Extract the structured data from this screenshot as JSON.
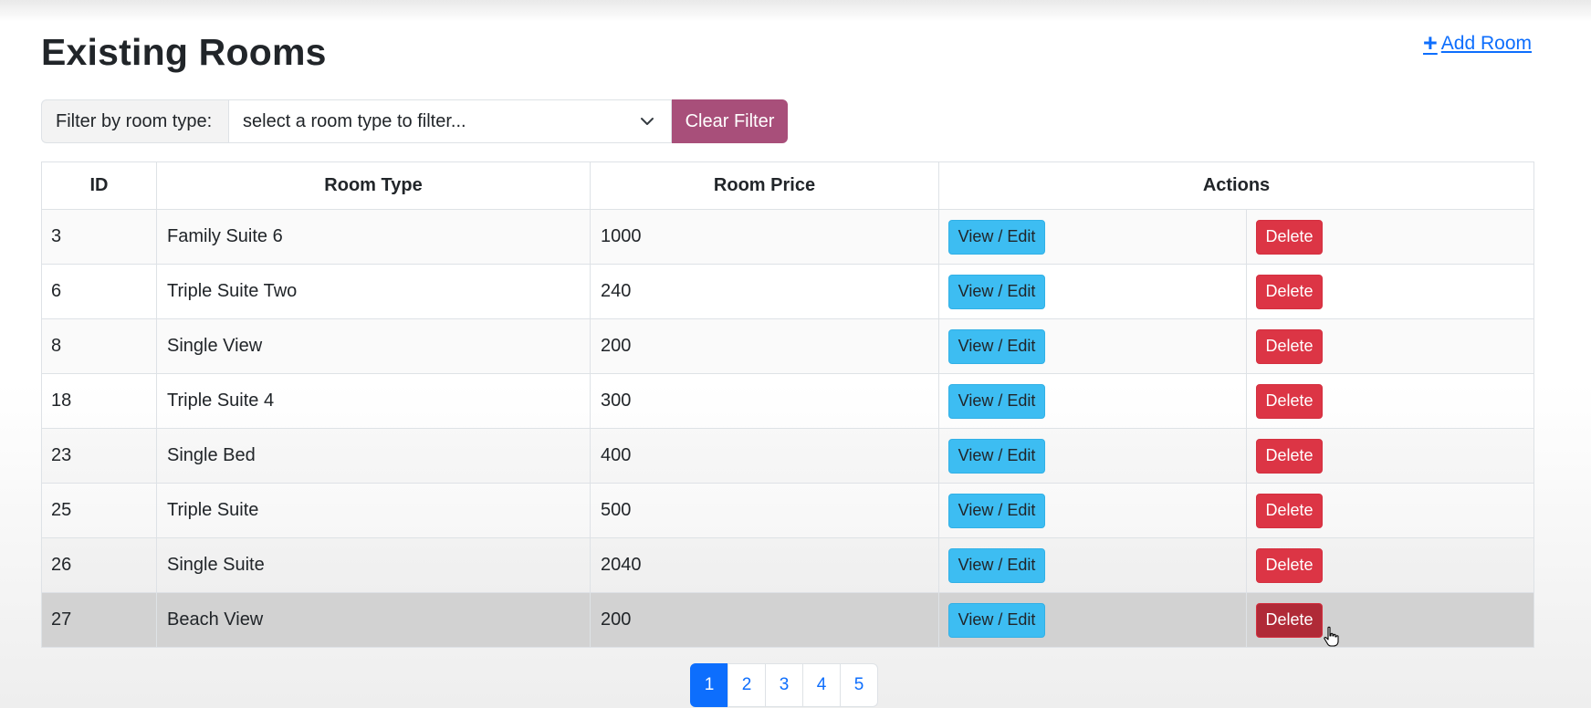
{
  "header": {
    "title": "Existing Rooms",
    "add_room_icon": "plus-icon",
    "add_room_label": "Add Room"
  },
  "filter": {
    "label": "Filter by room type:",
    "placeholder": "select a room type to filter...",
    "clear_label": "Clear Filter"
  },
  "table": {
    "columns": [
      "ID",
      "Room Type",
      "Room Price",
      "Actions"
    ],
    "view_edit_label": "View / Edit",
    "delete_label": "Delete",
    "rows": [
      {
        "id": "3",
        "type": "Family Suite 6",
        "price": "1000"
      },
      {
        "id": "6",
        "type": "Triple Suite Two",
        "price": "240"
      },
      {
        "id": "8",
        "type": "Single View",
        "price": "200"
      },
      {
        "id": "18",
        "type": "Triple Suite 4",
        "price": "300"
      },
      {
        "id": "23",
        "type": "Single Bed",
        "price": "400"
      },
      {
        "id": "25",
        "type": "Triple Suite",
        "price": "500"
      },
      {
        "id": "26",
        "type": "Single Suite",
        "price": "2040"
      },
      {
        "id": "27",
        "type": "Beach View",
        "price": "200"
      }
    ]
  },
  "pagination": {
    "pages": [
      "1",
      "2",
      "3",
      "4",
      "5"
    ],
    "active_page": "1"
  },
  "colors": {
    "primary": "#0d6efd",
    "clear_filter": "#a84f7a",
    "view_edit": "#3dbdf2",
    "delete": "#dc3545"
  }
}
